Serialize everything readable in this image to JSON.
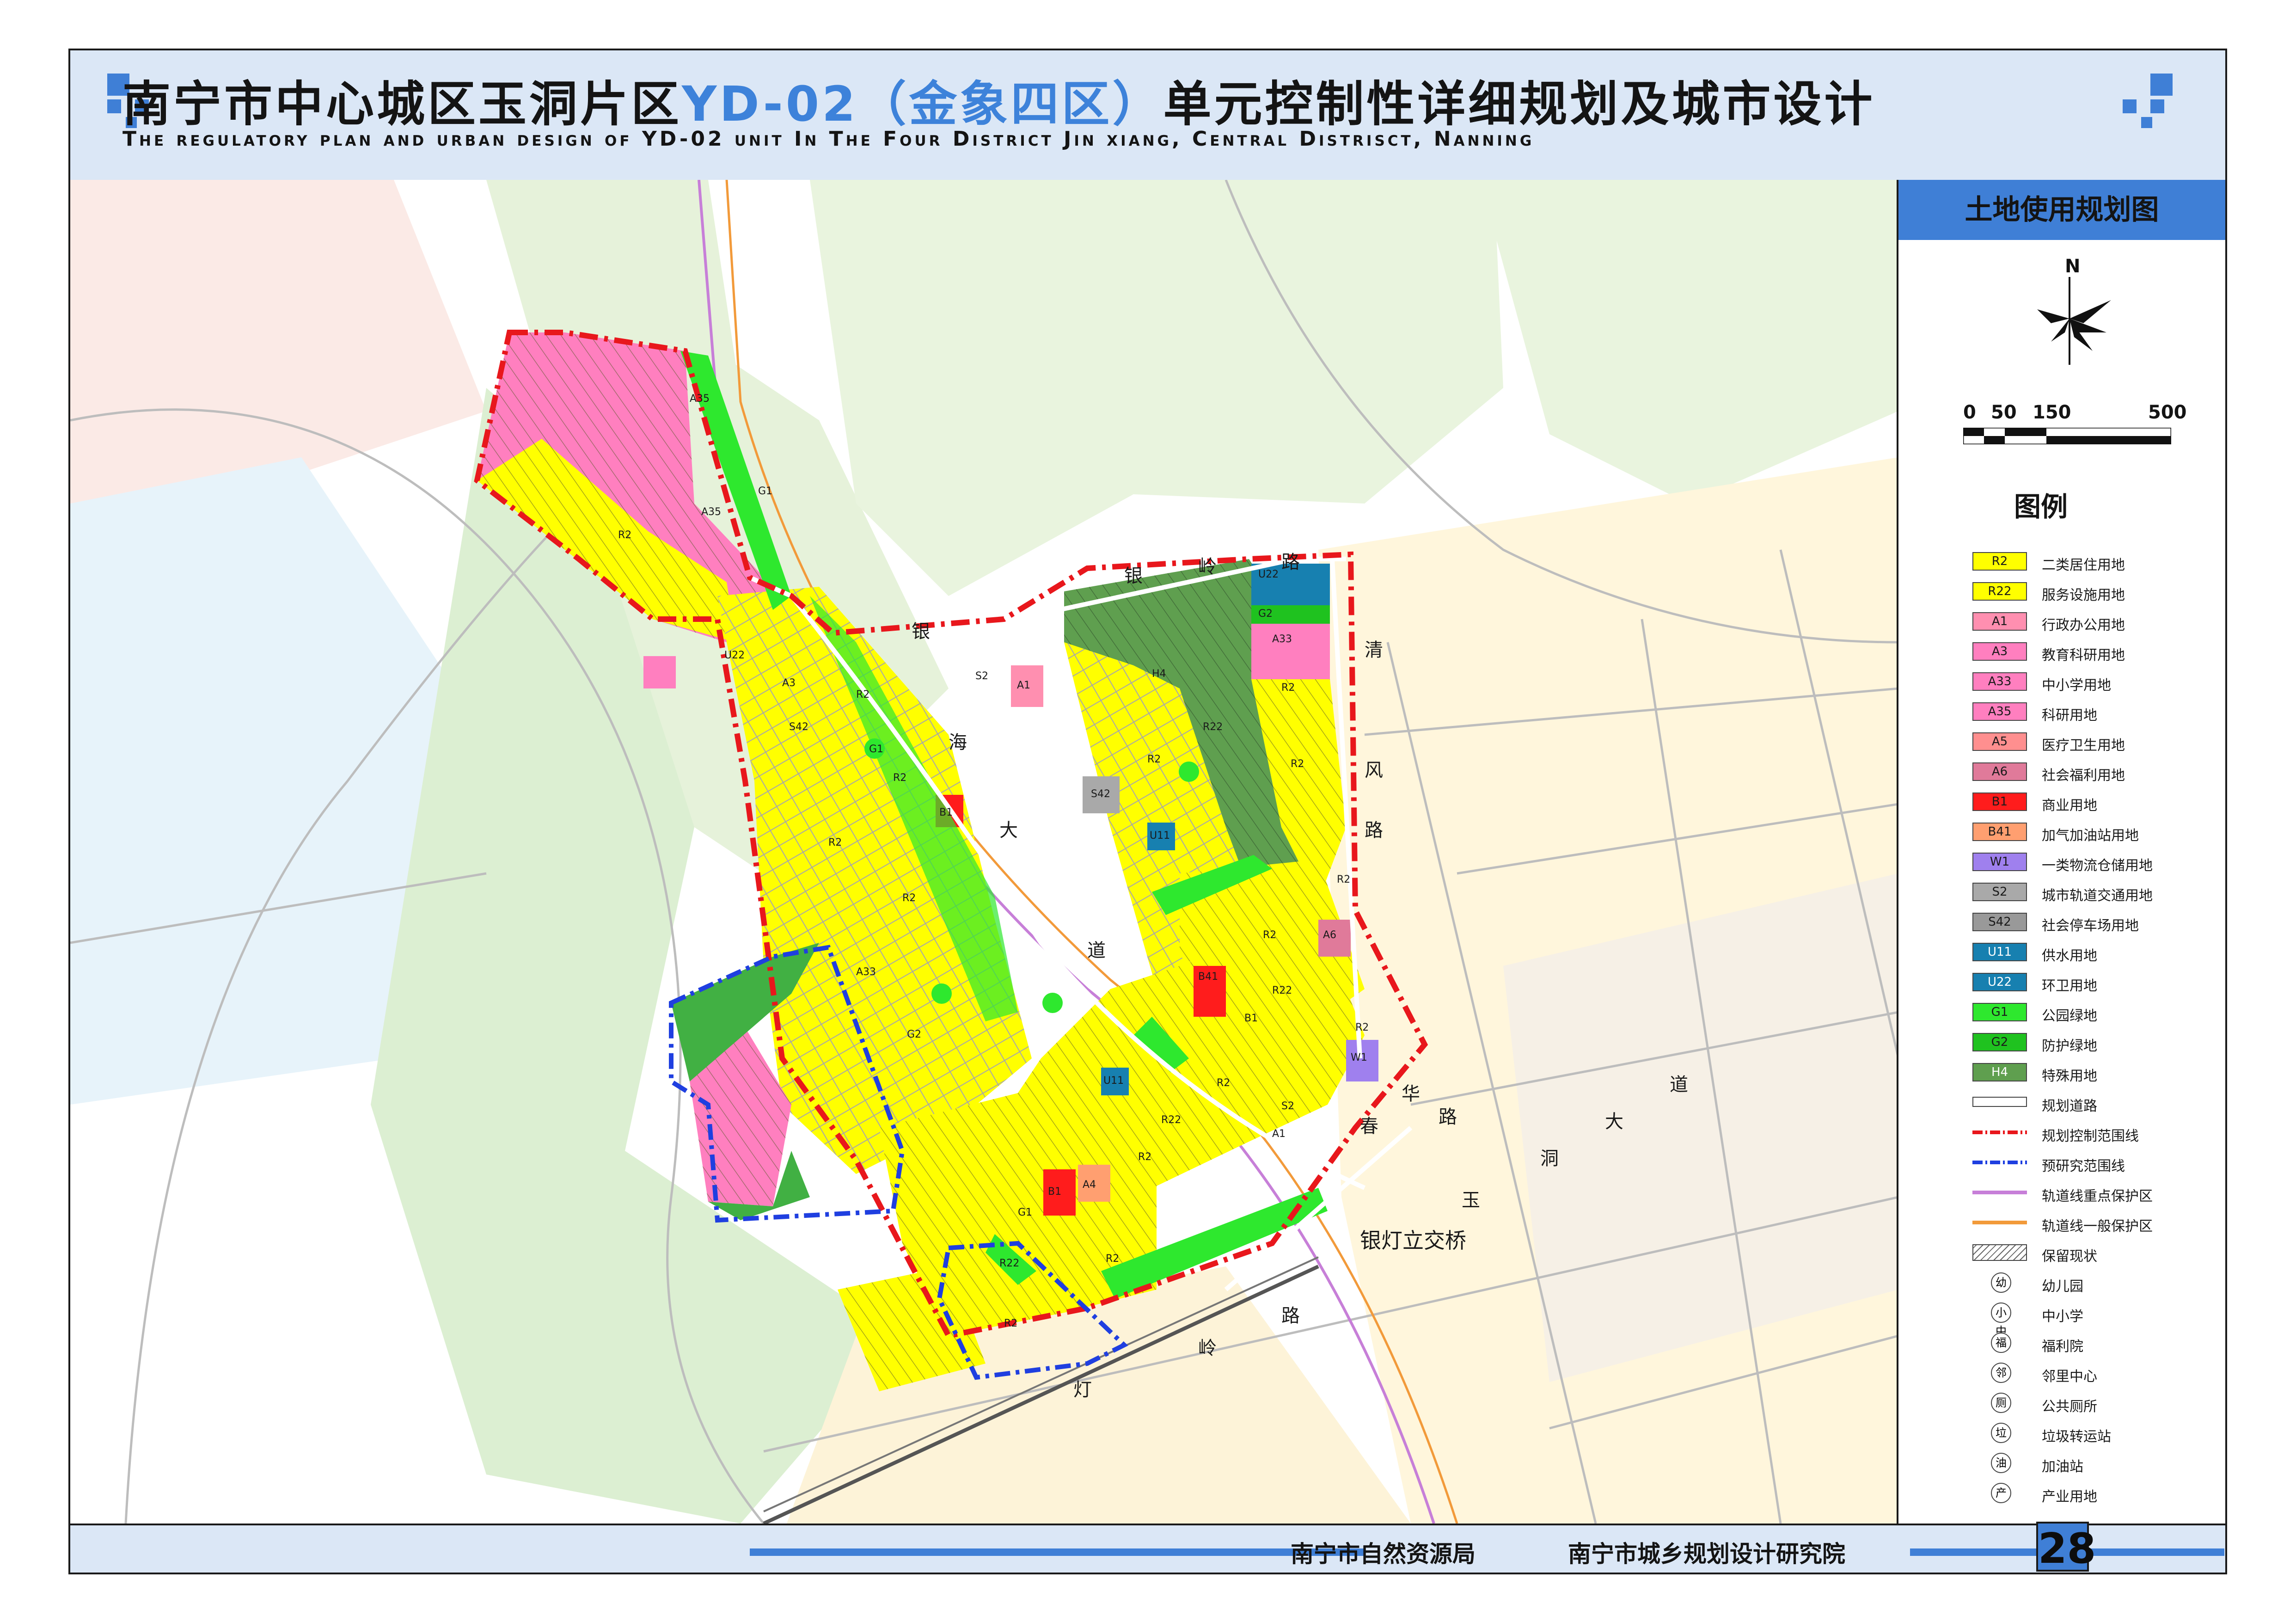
{
  "header": {
    "title_part1": "南宁市中心城区玉洞片区",
    "title_highlight": "YD-02（金象四区）",
    "title_part2": "单元控制性详细规划及城市设计",
    "subtitle_en": "The regulatory plan and urban design of YD-02 unit In The Four District Jin xiang, Central Distrisct, Nanning"
  },
  "panel": {
    "title": "土地使用规划图",
    "north_label": "N",
    "scale_labels": [
      "0",
      "50",
      "150",
      "500"
    ],
    "legend_title": "图例"
  },
  "legend": [
    {
      "code": "R2",
      "label": "二类居住用地",
      "color": "#ffff00"
    },
    {
      "code": "R22",
      "label": "服务设施用地",
      "color": "#ffff00"
    },
    {
      "code": "A1",
      "label": "行政办公用地",
      "color": "#ff8fb0"
    },
    {
      "code": "A3",
      "label": "教育科研用地",
      "color": "#ff7fbf"
    },
    {
      "code": "A33",
      "label": "中小学用地",
      "color": "#ff7fbf"
    },
    {
      "code": "A35",
      "label": "科研用地",
      "color": "#ff7fbf"
    },
    {
      "code": "A5",
      "label": "医疗卫生用地",
      "color": "#ff8f8f"
    },
    {
      "code": "A6",
      "label": "社会福利用地",
      "color": "#e07a9a"
    },
    {
      "code": "B1",
      "label": "商业用地",
      "color": "#ff1c1c"
    },
    {
      "code": "B41",
      "label": "加气加油站用地",
      "color": "#ff9f70"
    },
    {
      "code": "W1",
      "label": "一类物流仓储用地",
      "color": "#9f80ee"
    },
    {
      "code": "S2",
      "label": "城市轨道交通用地",
      "color": "#a9a9a9"
    },
    {
      "code": "S42",
      "label": "社会停车场用地",
      "color": "#999999"
    },
    {
      "code": "U11",
      "label": "供水用地",
      "color": "#1780b0"
    },
    {
      "code": "U22",
      "label": "环卫用地",
      "color": "#1780b0"
    },
    {
      "code": "G1",
      "label": "公园绿地",
      "color": "#2ee82e"
    },
    {
      "code": "G2",
      "label": "防护绿地",
      "color": "#1fc21f"
    },
    {
      "code": "H4",
      "label": "特殊用地",
      "color": "#5f9f4f"
    },
    {
      "code": "",
      "label": "规划道路",
      "color": "#ffffff"
    },
    {
      "code": "",
      "label": "规划控制范围线",
      "color": "#e8171c"
    },
    {
      "code": "",
      "label": "预研究范围线",
      "color": "#1f3fe0"
    },
    {
      "code": "",
      "label": "轨道线重点保护区",
      "color": "#c77fd8"
    },
    {
      "code": "",
      "label": "轨道线一般保护区",
      "color": "#f29a3a"
    },
    {
      "code": "",
      "label": "保留现状",
      "color": "#888888"
    },
    {
      "code": "幼",
      "label": "幼儿园",
      "color": "#ffffff"
    },
    {
      "code": "小 中",
      "label": "中小学",
      "color": "#ffffff"
    },
    {
      "code": "福",
      "label": "福利院",
      "color": "#ffffff"
    },
    {
      "code": "邻",
      "label": "邻里中心",
      "color": "#ffffff"
    },
    {
      "code": "厕",
      "label": "公共厕所",
      "color": "#ffffff"
    },
    {
      "code": "垃",
      "label": "垃圾转运站",
      "color": "#ffffff"
    },
    {
      "code": "油",
      "label": "加油站",
      "color": "#ffffff"
    },
    {
      "code": "产",
      "label": "产业用地",
      "color": "#ffffff"
    }
  ],
  "map": {
    "road_labels": {
      "yinhai_1": "银",
      "yinhai_2": "海",
      "yinhai_3": "大",
      "yinhai_4": "道",
      "yinling_1": "银",
      "yinling_2": "岭",
      "yinling_3": "路",
      "qingfeng_1": "清",
      "qingfeng_2": "风",
      "qingfeng_3": "路",
      "chunhua_1": "华",
      "chunhua_2": "路",
      "chunhua_3": "春",
      "yudong_1": "玉",
      "yudong_2": "洞",
      "yudong_3": "大",
      "yudong_4": "道",
      "south_1": "路",
      "south_2": "岭",
      "south_3": "灯",
      "interchange": "银灯立交桥"
    },
    "parcel_labels": [
      "A35",
      "A35",
      "R2",
      "G1",
      "U22",
      "A3",
      "S42",
      "R2",
      "R2",
      "R2",
      "B1",
      "G1",
      "A33",
      "R2",
      "G2",
      "H4",
      "U22",
      "G2",
      "A33",
      "R2",
      "R2",
      "R2",
      "R22",
      "U11",
      "S42",
      "A1",
      "S2",
      "A6",
      "R22",
      "B41",
      "B1",
      "W1",
      "R2",
      "U11",
      "R2",
      "A4",
      "B1",
      "R22",
      "R2",
      "R2",
      "R22",
      "R2",
      "G1",
      "A1",
      "S2",
      "R2",
      "R2"
    ]
  },
  "footer": {
    "org1": "南宁市自然资源局",
    "org2": "南宁市城乡规划设计研究院",
    "page": "28"
  }
}
